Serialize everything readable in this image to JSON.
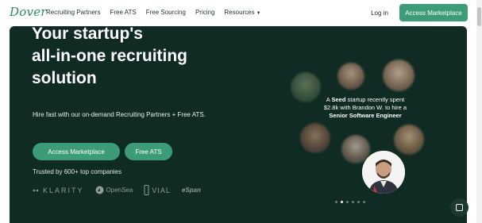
{
  "nav": {
    "logo": "Dover",
    "links": [
      "Recruiting Partners",
      "Free ATS",
      "Free Sourcing",
      "Pricing",
      "Resources"
    ],
    "login": "Log in",
    "cta": "Access Marketplace"
  },
  "hero": {
    "title_line1": "Your startup's",
    "title_line2": "all-in-one recruiting",
    "title_line3": "solution",
    "subtitle": "Hire fast with our on-demand Recruiting Partners + Free ATS.",
    "btn_marketplace": "Access Marketplace",
    "btn_ats": "Free ATS",
    "trusted": "Trusted by 600+ top companies",
    "logos": [
      "KLARITY",
      "OpenSea",
      "VIAL",
      "eSpan"
    ]
  },
  "testimonial": {
    "line1_prefix": "A",
    "line1_bold": "Seed",
    "line1_suffix": "startup recently spent",
    "line2": "$2.8k with Brandon W. to hire a",
    "line3": "Senior Software Engineer"
  },
  "colors": {
    "accent": "#3c9c78",
    "hero_bg": "#0f2b23"
  },
  "carousel": {
    "active_index": 1,
    "count": 6
  }
}
